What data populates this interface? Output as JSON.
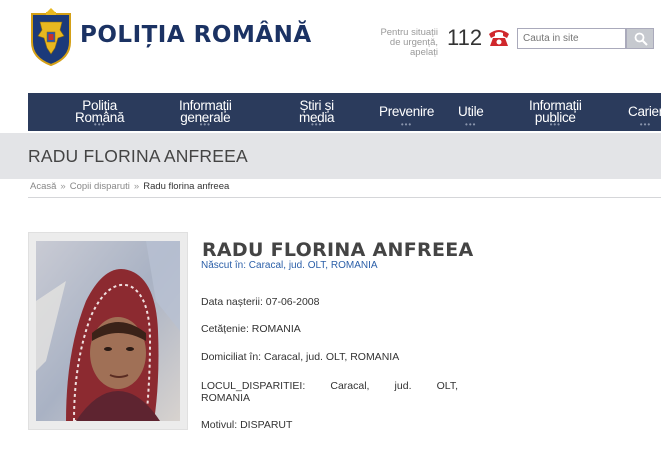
{
  "header": {
    "brand": "POLIȚIA ROMÂNĂ",
    "emergency_line1": "Pentru situații",
    "emergency_line2": "de urgență,",
    "emergency_line3": "apelați",
    "emergency_number": "112",
    "phone_icon": "phone-icon",
    "logo_icon": "coat-of-arms-logo",
    "search_placeholder": "Cauta in site",
    "search_icon": "search-icon"
  },
  "nav": {
    "items": [
      {
        "label_line1": "Poliția",
        "label_line2": "Română",
        "dots": "•••"
      },
      {
        "label_line1": "Informații",
        "label_line2": "generale",
        "dots": "•••"
      },
      {
        "label_line1": "Știri și",
        "label_line2": "media",
        "dots": "•••"
      },
      {
        "label_line1": "Prevenire",
        "label_line2": "",
        "dots": "•••"
      },
      {
        "label_line1": "Utile",
        "label_line2": "",
        "dots": "•••"
      },
      {
        "label_line1": "Informații",
        "label_line2": "publice",
        "dots": "•••"
      },
      {
        "label_line1": "Carier",
        "label_line2": "",
        "dots": "•••"
      }
    ]
  },
  "page": {
    "title": "RADU FLORINA ANFREEA"
  },
  "breadcrumb": {
    "items": [
      "Acasă",
      "Copii disparuti",
      "Radu florina anfreea"
    ],
    "separator": "»"
  },
  "person": {
    "name": "RADU FLORINA ANFREEA",
    "born": "Născut în: Caracal, jud. OLT, ROMANIA",
    "dob": "Data nașterii: 07-06-2008",
    "citizenship": "Cetățenie: ROMANIA",
    "domicile": "Domiciliat în: Caracal, jud. OLT, ROMANIA",
    "place_line1": "LOCUL_DISPARITIEI: Caracal, jud. OLT,",
    "place_line2": "ROMANIA",
    "reason": "Motivul: DISPARUT"
  },
  "colors": {
    "brand": "#1b3263",
    "nav_bg": "#2b3b5c",
    "link": "#2b5fa8",
    "phone": "#d0272c"
  }
}
